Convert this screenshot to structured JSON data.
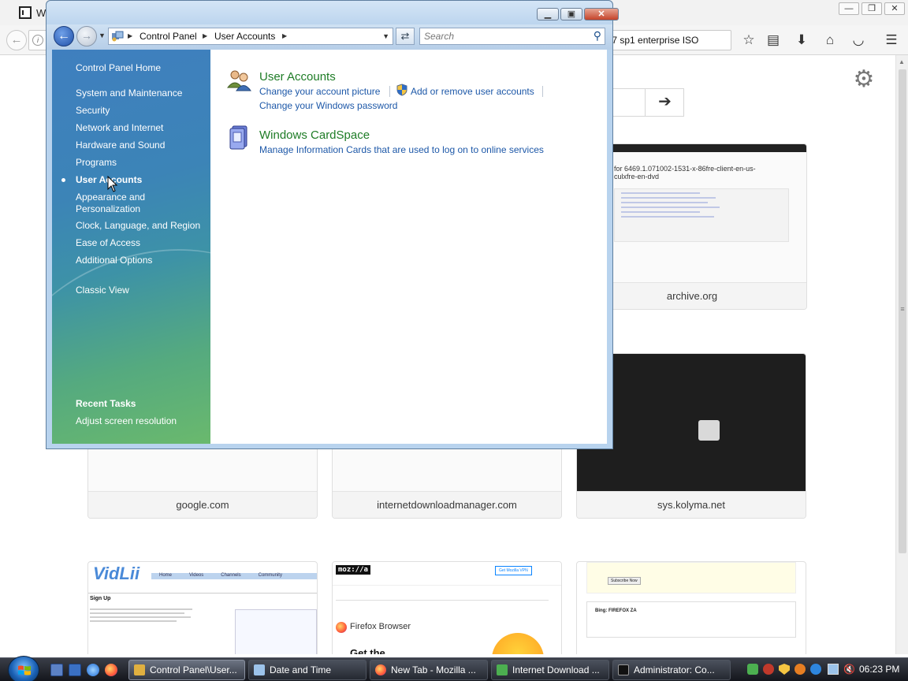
{
  "firefox": {
    "window_title": "W",
    "url_text": "s 7 sp1 enterprise ISO",
    "tiles": [
      {
        "label": "archive.org",
        "thumb_title": "for 6469.1.071002-1531-x-86fre-client-en-us-culxfre-en-dvd"
      },
      {
        "label": "google.com"
      },
      {
        "label": "internetdownloadmanager.com"
      },
      {
        "label": "sys.kolyma.net"
      },
      {
        "thumb_logo": "VidLii",
        "thumb_heading": "Sign Up",
        "thumb_nav": [
          "Home",
          "Videos",
          "Channels",
          "Community"
        ]
      },
      {
        "thumb_logo": "moz://a",
        "thumb_btn": "Get Mozilla VPN",
        "thumb_heading": "Firefox Browser",
        "thumb_sub": "Get the"
      },
      {
        "thumb_heading": "Bing: FIREFOX ZA",
        "thumb_btn": "Subscribe Now"
      }
    ]
  },
  "control_panel": {
    "breadcrumbs": [
      "Control Panel",
      "User Accounts"
    ],
    "search_placeholder": "Search",
    "sidebar": {
      "home": "Control Panel Home",
      "items": [
        "System and Maintenance",
        "Security",
        "Network and Internet",
        "Hardware and Sound",
        "Programs",
        "User Accounts",
        "Appearance and\nPersonalization",
        "Clock, Language, and Region",
        "Ease of Access",
        "Additional Options"
      ],
      "classic_view": "Classic View",
      "recent_tasks_heading": "Recent Tasks",
      "recent_tasks": [
        "Adjust screen resolution"
      ]
    },
    "categories": [
      {
        "title": "User Accounts",
        "links": [
          "Change your account picture",
          "Add or remove user accounts",
          "Change your Windows password"
        ]
      },
      {
        "title": "Windows CardSpace",
        "links": [
          "Manage Information Cards that are used to log on to online services"
        ]
      }
    ]
  },
  "taskbar": {
    "tasks": [
      {
        "label": "Control Panel\\User...",
        "active": true
      },
      {
        "label": "Date and Time"
      },
      {
        "label": "New Tab - Mozilla ..."
      },
      {
        "label": "Internet Download ..."
      },
      {
        "label": "Administrator: Co..."
      }
    ],
    "clock": "06:23 PM"
  },
  "colors": {
    "link": "#1d58a8",
    "category_title": "#1e7c26",
    "sidebar_top": "#3f7fbf",
    "sidebar_bottom": "#6ab96d"
  }
}
